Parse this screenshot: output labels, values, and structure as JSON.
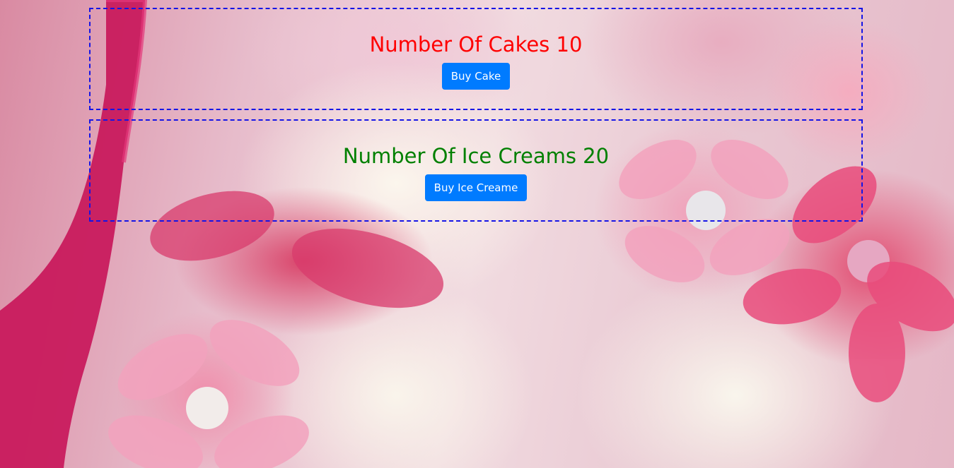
{
  "cake": {
    "heading_prefix": "Number Of Cakes",
    "count": "10",
    "button_label": "Buy Cake"
  },
  "icecream": {
    "heading_prefix": "Number Of Ice Creams",
    "count": "20",
    "button_label": "Buy Ice Creame"
  },
  "colors": {
    "cake_heading": "#ff0000",
    "icecream_heading": "#008000",
    "button_bg": "#007bff",
    "card_border": "#1414e6"
  },
  "background": {
    "description_icon": "cupcake-background-image"
  }
}
